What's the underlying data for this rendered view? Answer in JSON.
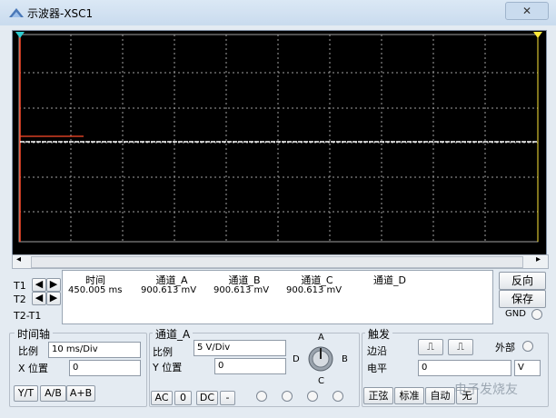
{
  "window": {
    "title": "示波器-XSC1",
    "close": "✕"
  },
  "cursor_table": {
    "rows": [
      "T1",
      "T2",
      "T2-T1"
    ],
    "headers": [
      "时间",
      "通道_A",
      "通道_B",
      "通道_C",
      "通道_D"
    ],
    "values": [
      "450.005 ms",
      "900.613 mV",
      "900.613 mV",
      "900.613 mV",
      ""
    ]
  },
  "side_buttons": {
    "reverse": "反向",
    "save": "保存",
    "gnd": "GND"
  },
  "timebase": {
    "label": "时间轴",
    "scale_label": "比例",
    "scale_value": "10 ms/Div",
    "xpos_label": "X 位置",
    "xpos_value": "0",
    "modes": [
      "Y/T",
      "A/B",
      "A+B"
    ]
  },
  "channel_a": {
    "label": "通道_A",
    "scale_label": "比例",
    "scale_value": "5  V/Div",
    "ypos_label": "Y 位置",
    "ypos_value": "0",
    "coupling": [
      "AC",
      "0",
      "DC",
      "-"
    ]
  },
  "selector": {
    "a": "A",
    "b": "B",
    "c": "C",
    "d": "D"
  },
  "trigger": {
    "label": "触发",
    "edge_label": "边沿",
    "external_label": "外部",
    "level_label": "电平",
    "level_value": "0",
    "level_unit": "V",
    "modes": [
      "正弦",
      "标准",
      "自动",
      "无"
    ]
  },
  "watermark": "电子发烧友",
  "colors": {
    "trace": "#ffffff",
    "marker": "#ff4b2b",
    "grid": "#9a9a9a",
    "cursor1": "#2ecbd0",
    "cursor2": "#ffe83a"
  }
}
